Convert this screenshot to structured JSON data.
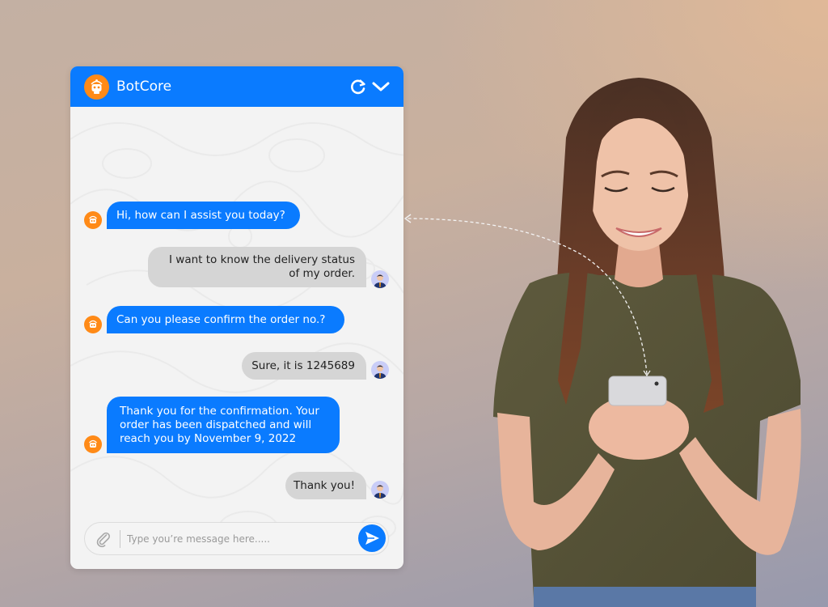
{
  "chat_widget": {
    "title": "BotCore",
    "header_icons": [
      "robot-logo-icon",
      "refresh-icon",
      "chevron-down-icon"
    ],
    "accent_color": "#0a7bff",
    "logo_color": "#ff8a17",
    "messages": [
      {
        "sender": "bot",
        "lines": [
          "Hi, how can I assist you today?"
        ]
      },
      {
        "sender": "user",
        "lines": [
          "I want to know the delivery status",
          "of my order."
        ]
      },
      {
        "sender": "bot",
        "lines": [
          "Can you please confirm the order no.?"
        ]
      },
      {
        "sender": "user",
        "lines": [
          "Sure, it is 1245689"
        ]
      },
      {
        "sender": "bot",
        "lines": [
          "Thank you for the confirmation. Your",
          "order has been dispatched and will",
          "reach you by November 9, 2022"
        ]
      },
      {
        "sender": "user",
        "lines": [
          "Thank you!"
        ]
      }
    ],
    "input": {
      "placeholder": "Type you’re message here.....",
      "value": ""
    }
  },
  "illustration": {
    "subject": "smiling woman in olive t-shirt holding a smartphone",
    "connector": "dashed arrow from phone to chat widget"
  }
}
